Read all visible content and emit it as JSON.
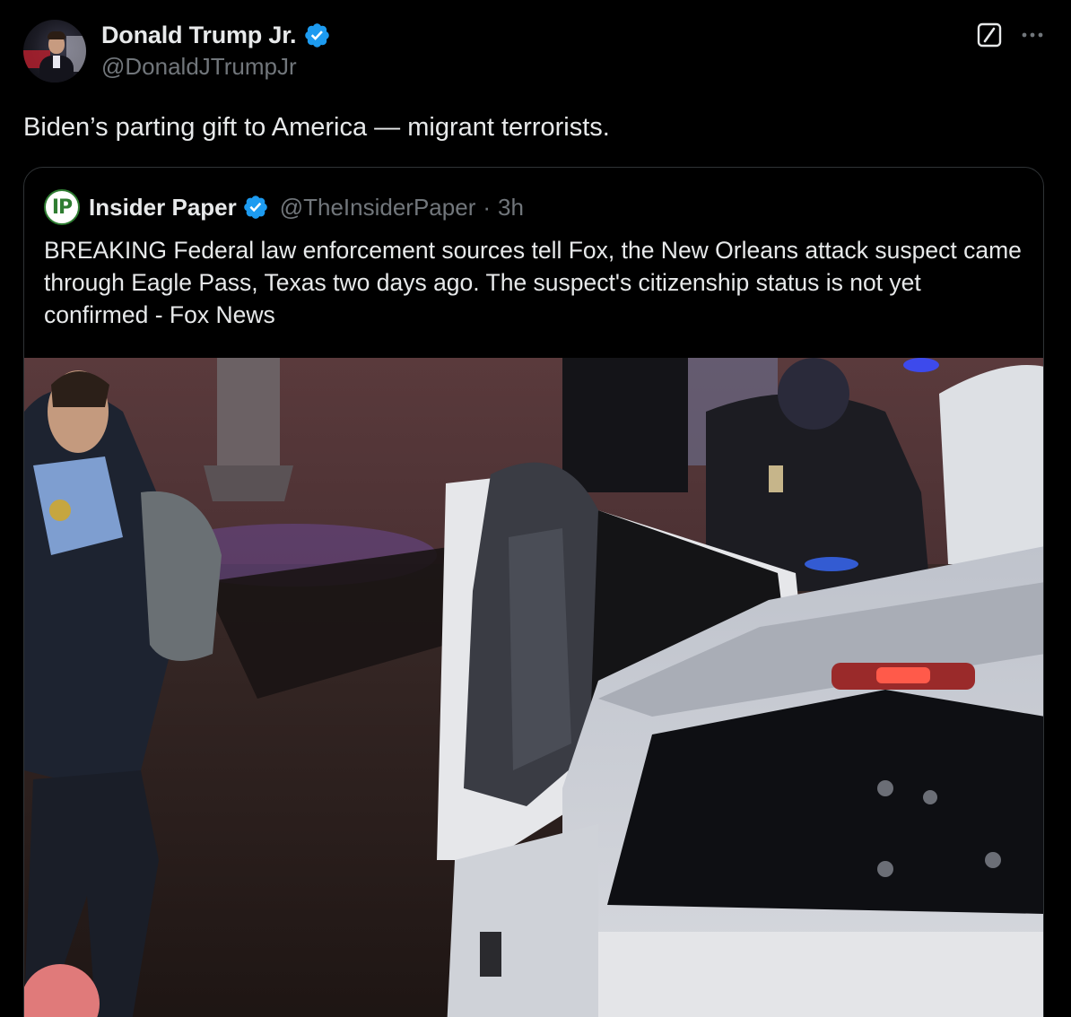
{
  "author": {
    "display_name": "Donald Trump Jr.",
    "handle": "@DonaldJTrumpJr",
    "verified": true,
    "avatar_icon": "profile-photo"
  },
  "post": {
    "text": "Biden’s parting gift to America — migrant terrorists."
  },
  "top_actions": {
    "grok_icon": "grok-icon",
    "more_icon": "more-icon"
  },
  "quoted_post": {
    "display_name": "Insider Paper",
    "avatar_text": "IP",
    "handle": "@TheInsiderPaper",
    "separator": "·",
    "time": "3h",
    "verified": true,
    "text": "BREAKING Federal law enforcement sources tell Fox, the New Orleans attack suspect came through Eagle Pass, Texas two days ago. The suspect's citizenship status is not yet confirmed - Fox News"
  },
  "colors": {
    "background": "#000000",
    "text_primary": "#e7e9ea",
    "text_secondary": "#71767b",
    "border": "#2f3336",
    "verified_blue": "#1d9bf0",
    "insider_green": "#2f7d32"
  }
}
